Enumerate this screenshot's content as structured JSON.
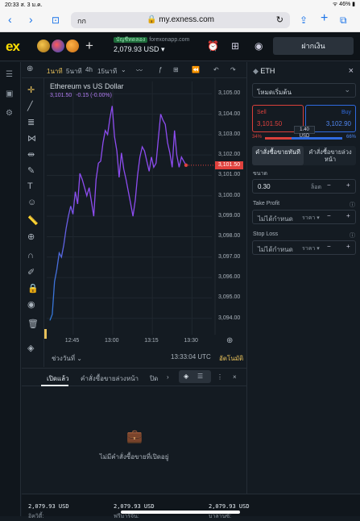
{
  "ios": {
    "time": "20:33  ส. 3 ม.ค.",
    "right": "ᯤ 46% ▮"
  },
  "safari": {
    "aa": "กก",
    "url": "🔒 my.exness.com",
    "back": "‹",
    "fwd": "›",
    "book": "⊡",
    "share": "⇪",
    "add": "+",
    "tabs": "⧉"
  },
  "header": {
    "logo": "ex",
    "account_type": "บัญชีทดลอง",
    "server": "forexonapp.com",
    "balance": "2,079.93 USD ▾",
    "deposit": "ฝากเงิน",
    "plus": "+"
  },
  "chart_toolbar": {
    "plus": "⊕",
    "timeframes": [
      "1นาที",
      "5นาที",
      "4h",
      "15นาที"
    ],
    "chevron": "⌄",
    "icons": [
      "〰",
      "ƒ",
      "⊞",
      "⏪",
      "↶",
      "↷"
    ]
  },
  "chart": {
    "title": "Ethereum vs US Dollar",
    "price": "3,101.50",
    "change": "-0.15 (-0.00%)",
    "flag": "3,101.50",
    "range_btn": "ช่วงวันที่ ⌄",
    "clock": "13:33:04 UTC",
    "auto": "อัตโนมัติ"
  },
  "chart_data": {
    "type": "line",
    "title": "Ethereum vs US Dollar",
    "xlabel": "",
    "ylabel": "",
    "xticks": [
      "12:45",
      "13:00",
      "13:15",
      "13:30"
    ],
    "yticks": [
      3105,
      3104,
      3103,
      3102,
      3101,
      3100,
      3099,
      3098,
      3097,
      3096,
      3095,
      3094
    ],
    "ylim": [
      3093.2,
      3105.6
    ],
    "series": [
      {
        "color_start": "#2e7bd6",
        "color_end": "#8d4cf0",
        "x": [
          0,
          1,
          2,
          3,
          4,
          5,
          6,
          7,
          8,
          9,
          10,
          11,
          12,
          13,
          14,
          15,
          16,
          17,
          18,
          19,
          20,
          21,
          22,
          23,
          24,
          25,
          26,
          27,
          28,
          29,
          30,
          31,
          32,
          33,
          34,
          35,
          36,
          37,
          38,
          39,
          40,
          41,
          42,
          43,
          44,
          45,
          46,
          47,
          48,
          49,
          50,
          51,
          52,
          53,
          54,
          55,
          56,
          57,
          58,
          59
        ],
        "y": [
          3093.9,
          3094.2,
          3095.8,
          3096.4,
          3097.2,
          3097.0,
          3097.6,
          3098.4,
          3099.0,
          3099.5,
          3099.1,
          3100.2,
          3099.6,
          3101.1,
          3100.8,
          3100.4,
          3100.0,
          3100.4,
          3099.7,
          3099.0,
          3100.8,
          3101.6,
          3101.7,
          3102.6,
          3103.2,
          3103.0,
          3103.8,
          3104.4,
          3102.9,
          3102.2,
          3100.9,
          3102.1,
          3101.3,
          3100.8,
          3100.2,
          3099.6,
          3099.0,
          3099.8,
          3101.0,
          3101.9,
          3102.4,
          3102.2,
          3101.7,
          3101.2,
          3101.9,
          3101.4,
          3101.6,
          3102.8,
          3104.0,
          3103.7,
          3103.5,
          3102.6,
          3102.1,
          3101.4,
          3103.2,
          3102.0,
          3101.4,
          3101.9,
          3101.7,
          3101.5
        ]
      }
    ]
  },
  "right": {
    "symbol": "ETH",
    "close": "×",
    "mode": "โหมดเริ่มต้น",
    "sell_label": "Sell",
    "sell_price": "3,101.50",
    "buy_label": "Buy",
    "buy_price": "3,102.90",
    "spread": "1.40 USD",
    "sent_sell": "34%",
    "sent_buy": "66%",
    "sent_sell_fraction": 0.34,
    "tab_market": "คำสั่งซื้อขายทันที",
    "tab_pending": "คำสั่งซื้อขายล่วงหน้า",
    "volume_label": "ขนาด",
    "volume": "0.30",
    "volume_unit": "ล็อต",
    "tp_label": "Take Profit",
    "tp_value": "ไม่ได้กำหนด",
    "tp_unit": "ราคา ▾",
    "sl_label": "Stop Loss",
    "sl_value": "ไม่ได้กำหนด",
    "sl_unit": "ราคา ▾",
    "minus": "−",
    "plus": "+",
    "info": "ⓘ"
  },
  "bottom": {
    "tab_open": "เปิดแล้ว",
    "tab_pending": "คำสั่งซื้อขายล่วงหน้า",
    "tab_closed": "ปิด",
    "next": "›",
    "empty": "ไม่มีคำสั่งซื้อขายที่เปิดอยู่",
    "close": "×"
  },
  "footer": {
    "equity_label": "อิควิตี้:",
    "equity": "2,079.93 USD",
    "free_margin_label": "ฟรีมาร์จิ้น:",
    "free_margin": "2,079.93 USD",
    "balance_label": "บาลานซ์:",
    "balance": "2,079.93 USD"
  },
  "colors": {
    "brand": "#ffde02",
    "sell": "#e0413d",
    "buy": "#2f6ae0",
    "line": "#8d4cf0"
  }
}
